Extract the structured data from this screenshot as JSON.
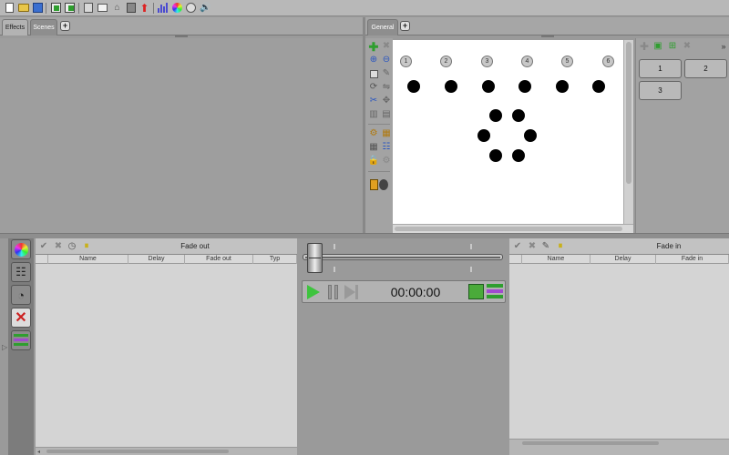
{
  "toolbar": {
    "icons": [
      "new-file-icon",
      "open-folder-icon",
      "save-icon",
      "import-icon",
      "export-icon",
      "palette-icon",
      "email-icon",
      "fixture-icon",
      "channels-icon",
      "upload-icon",
      "bar-chart-icon",
      "color-wheel-icon",
      "dmx-icon",
      "speaker-icon"
    ]
  },
  "left_tabs": {
    "effects": "Effects",
    "scenes": "Scenes",
    "add": "+"
  },
  "right_tabs": {
    "general": "General",
    "add": "+"
  },
  "fixture_numbers": [
    "1",
    "2",
    "3",
    "4",
    "5",
    "6"
  ],
  "scene_buttons": [
    "1",
    "2",
    "3"
  ],
  "fade_out": {
    "title": "Fade out",
    "columns": [
      "Name",
      "Delay",
      "Fade out",
      "Typ"
    ]
  },
  "fade_in": {
    "title": "Fade in",
    "columns": [
      "Name",
      "Delay",
      "Fade in"
    ]
  },
  "transport": {
    "time": "00:00:00"
  },
  "colors": {
    "play_green": "#3ec43e",
    "add_green": "#2f9e2f",
    "background": "#9a9a9a",
    "stage": "#ffffff"
  }
}
